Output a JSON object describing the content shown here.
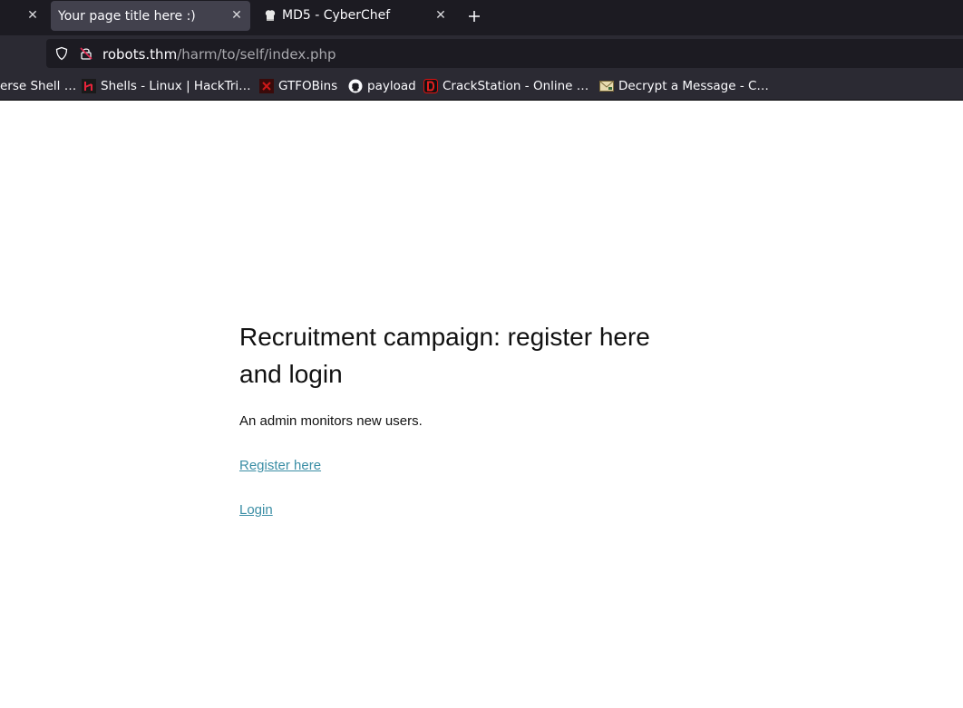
{
  "browser": {
    "tabs": [
      {
        "label": "",
        "active": false
      },
      {
        "label": "Your page title here :)",
        "active": true
      },
      {
        "label": "MD5 - CyberChef",
        "active": false
      }
    ],
    "url": {
      "host": "robots.thm",
      "path": "/harm/to/self/index.php"
    },
    "bookmarks": [
      {
        "label": "erse Shell …",
        "icon": "none"
      },
      {
        "label": "Shells - Linux | HackTri…",
        "icon": "hacktricks-favicon"
      },
      {
        "label": "GTFOBins",
        "icon": "gtfobins-favicon"
      },
      {
        "label": "payload",
        "icon": "github-favicon"
      },
      {
        "label": "CrackStation - Online …",
        "icon": "crackstation-favicon"
      },
      {
        "label": "Decrypt a Message - C…",
        "icon": "envelope-favicon"
      }
    ],
    "colors": {
      "tabbar": "#1c1b22",
      "toolbar": "#2b2a33",
      "active_tab": "#42414d"
    }
  },
  "page": {
    "title": "Recruitment campaign: register here and login",
    "description": "An admin monitors new users.",
    "register_link": "Register here",
    "login_link": "Login",
    "link_color": "#3b8ea5"
  }
}
